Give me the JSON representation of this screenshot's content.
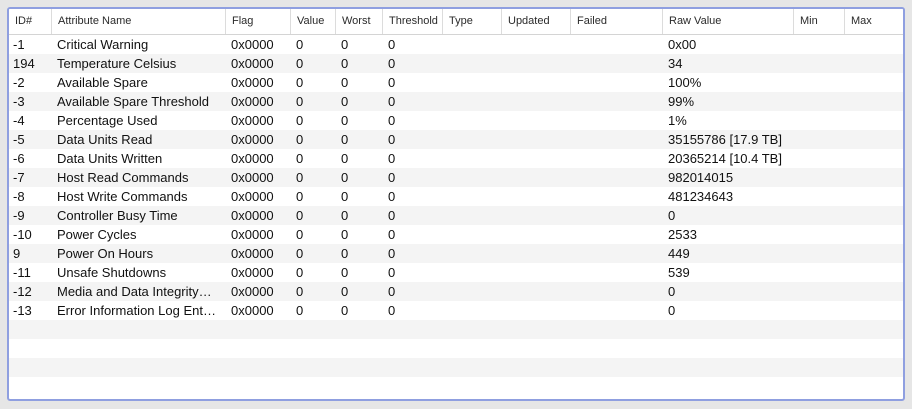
{
  "columns": [
    {
      "key": "id",
      "label": "ID#"
    },
    {
      "key": "name",
      "label": "Attribute Name"
    },
    {
      "key": "flag",
      "label": "Flag"
    },
    {
      "key": "value",
      "label": "Value"
    },
    {
      "key": "worst",
      "label": "Worst"
    },
    {
      "key": "threshold",
      "label": "Threshold"
    },
    {
      "key": "type",
      "label": "Type"
    },
    {
      "key": "updated",
      "label": "Updated"
    },
    {
      "key": "failed",
      "label": "Failed"
    },
    {
      "key": "raw",
      "label": "Raw Value"
    },
    {
      "key": "min",
      "label": "Min"
    },
    {
      "key": "max",
      "label": "Max"
    }
  ],
  "rows": [
    {
      "id": "-1",
      "name": "Critical Warning",
      "flag": "0x0000",
      "value": "0",
      "worst": "0",
      "threshold": "0",
      "type": "",
      "updated": "",
      "failed": "",
      "raw": "0x00",
      "min": "",
      "max": ""
    },
    {
      "id": "194",
      "name": "Temperature Celsius",
      "flag": "0x0000",
      "value": "0",
      "worst": "0",
      "threshold": "0",
      "type": "",
      "updated": "",
      "failed": "",
      "raw": "34",
      "min": "",
      "max": ""
    },
    {
      "id": "-2",
      "name": "Available Spare",
      "flag": "0x0000",
      "value": "0",
      "worst": "0",
      "threshold": "0",
      "type": "",
      "updated": "",
      "failed": "",
      "raw": "100%",
      "min": "",
      "max": ""
    },
    {
      "id": "-3",
      "name": "Available Spare Threshold",
      "flag": "0x0000",
      "value": "0",
      "worst": "0",
      "threshold": "0",
      "type": "",
      "updated": "",
      "failed": "",
      "raw": "99%",
      "min": "",
      "max": ""
    },
    {
      "id": "-4",
      "name": "Percentage Used",
      "flag": "0x0000",
      "value": "0",
      "worst": "0",
      "threshold": "0",
      "type": "",
      "updated": "",
      "failed": "",
      "raw": "1%",
      "min": "",
      "max": ""
    },
    {
      "id": "-5",
      "name": "Data Units Read",
      "flag": "0x0000",
      "value": "0",
      "worst": "0",
      "threshold": "0",
      "type": "",
      "updated": "",
      "failed": "",
      "raw": "35155786 [17.9 TB]",
      "min": "",
      "max": ""
    },
    {
      "id": "-6",
      "name": "Data Units Written",
      "flag": "0x0000",
      "value": "0",
      "worst": "0",
      "threshold": "0",
      "type": "",
      "updated": "",
      "failed": "",
      "raw": "20365214 [10.4 TB]",
      "min": "",
      "max": ""
    },
    {
      "id": "-7",
      "name": "Host Read Commands",
      "flag": "0x0000",
      "value": "0",
      "worst": "0",
      "threshold": "0",
      "type": "",
      "updated": "",
      "failed": "",
      "raw": "982014015",
      "min": "",
      "max": ""
    },
    {
      "id": "-8",
      "name": "Host Write Commands",
      "flag": "0x0000",
      "value": "0",
      "worst": "0",
      "threshold": "0",
      "type": "",
      "updated": "",
      "failed": "",
      "raw": "481234643",
      "min": "",
      "max": ""
    },
    {
      "id": "-9",
      "name": "Controller Busy Time",
      "flag": "0x0000",
      "value": "0",
      "worst": "0",
      "threshold": "0",
      "type": "",
      "updated": "",
      "failed": "",
      "raw": "0",
      "min": "",
      "max": ""
    },
    {
      "id": "-10",
      "name": "Power Cycles",
      "flag": "0x0000",
      "value": "0",
      "worst": "0",
      "threshold": "0",
      "type": "",
      "updated": "",
      "failed": "",
      "raw": "2533",
      "min": "",
      "max": ""
    },
    {
      "id": "9",
      "name": "Power On Hours",
      "flag": "0x0000",
      "value": "0",
      "worst": "0",
      "threshold": "0",
      "type": "",
      "updated": "",
      "failed": "",
      "raw": "449",
      "min": "",
      "max": ""
    },
    {
      "id": "-11",
      "name": "Unsafe Shutdowns",
      "flag": "0x0000",
      "value": "0",
      "worst": "0",
      "threshold": "0",
      "type": "",
      "updated": "",
      "failed": "",
      "raw": "539",
      "min": "",
      "max": ""
    },
    {
      "id": "-12",
      "name": "Media and Data Integrity…",
      "flag": "0x0000",
      "value": "0",
      "worst": "0",
      "threshold": "0",
      "type": "",
      "updated": "",
      "failed": "",
      "raw": "0",
      "min": "",
      "max": ""
    },
    {
      "id": "-13",
      "name": "Error Information Log Ent…",
      "flag": "0x0000",
      "value": "0",
      "worst": "0",
      "threshold": "0",
      "type": "",
      "updated": "",
      "failed": "",
      "raw": "0",
      "min": "",
      "max": ""
    }
  ],
  "empty_row_count": 4,
  "colors": {
    "frame_border": "#8f9fe0",
    "row_alt": "#f4f4f4",
    "window_bg": "#e6e6e6"
  }
}
